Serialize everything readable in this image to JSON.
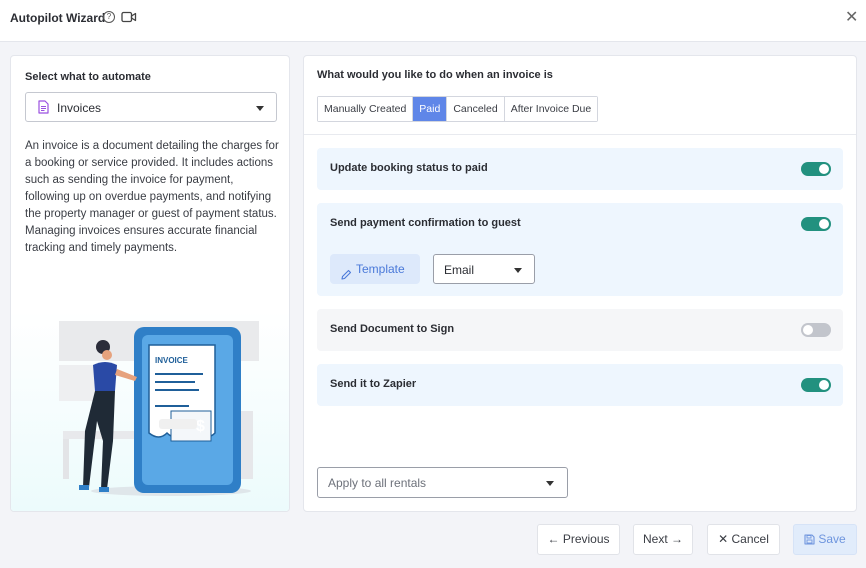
{
  "window": {
    "title": "Autopilot Wizard",
    "help_glyph": "?",
    "close_glyph": "✕",
    "icons": [
      "help-circle-icon",
      "video-camera-icon",
      "close-icon"
    ]
  },
  "left": {
    "select_label": "Select what to automate",
    "selected_value": "Invoices",
    "selected_icon": "document-icon",
    "description": "An invoice is a document detailing the charges for a booking or service provided. It includes actions such as sending the invoice for payment, following up on overdue payments, and notifying the property manager or guest of payment status. Managing invoices ensures accurate financial tracking and timely payments.",
    "illustration": {
      "invoice_title": "INVOICE",
      "currency_symbol": "$"
    }
  },
  "right": {
    "question": "What would you like to do when an invoice is",
    "tabs": [
      {
        "label": "Manually Created",
        "active": false
      },
      {
        "label": "Paid",
        "active": true
      },
      {
        "label": "Canceled",
        "active": false
      },
      {
        "label": "After Invoice Due",
        "active": false
      }
    ],
    "actions": [
      {
        "label": "Update booking status to paid",
        "enabled": true
      },
      {
        "label": "Send payment confirmation to guest",
        "enabled": true,
        "template_button": "Template",
        "channel": "Email"
      },
      {
        "label": "Send Document to Sign",
        "enabled": false
      },
      {
        "label": "Send it to Zapier",
        "enabled": true
      }
    ],
    "rentals_placeholder": "Apply to all rentals"
  },
  "footer": {
    "previous": "← Previous",
    "next": "Next →",
    "cancel": "✕ Cancel",
    "save": "Save"
  },
  "colors": {
    "accent": "#5f86e8",
    "toggle_on": "#22917f",
    "toggle_off": "#c2c5cc",
    "card_bg": "#eef6fe",
    "save_bg": "#e1ecfb"
  }
}
